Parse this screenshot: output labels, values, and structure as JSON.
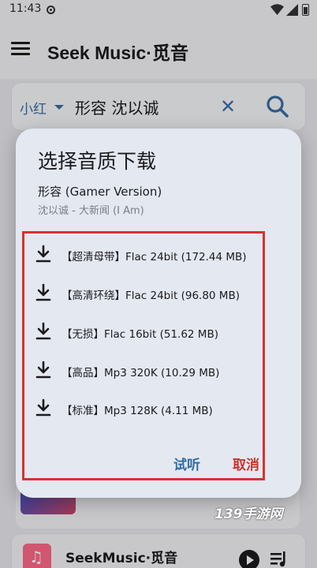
{
  "status_bar": {
    "time": "11:43"
  },
  "app_bar": {
    "title": "Seek Music·觅音"
  },
  "search": {
    "scope": "小红",
    "query": "形容 沈以诚"
  },
  "dialog": {
    "title": "选择音质下载",
    "song_title": "形容 (Gamer Version)",
    "song_meta": "沈以诚 - 大新闻 (I Am)",
    "options": [
      {
        "label": "【超清母带】Flac 24bit (172.44 MB)"
      },
      {
        "label": "【高清环绕】Flac 24bit (96.80 MB)"
      },
      {
        "label": "【无损】Flac 16bit (51.62 MB)"
      },
      {
        "label": "【高品】Mp3 320K (10.29 MB)"
      },
      {
        "label": "【标准】Mp3 128K (4.11 MB)"
      }
    ],
    "listen_label": "试听",
    "cancel_label": "取消"
  },
  "player": {
    "title": "SeekMusic·觅音"
  },
  "watermark": "139手游网",
  "colors": {
    "accent": "#3a6ea5",
    "danger": "#c8362c",
    "highlight": "#d8322f"
  }
}
